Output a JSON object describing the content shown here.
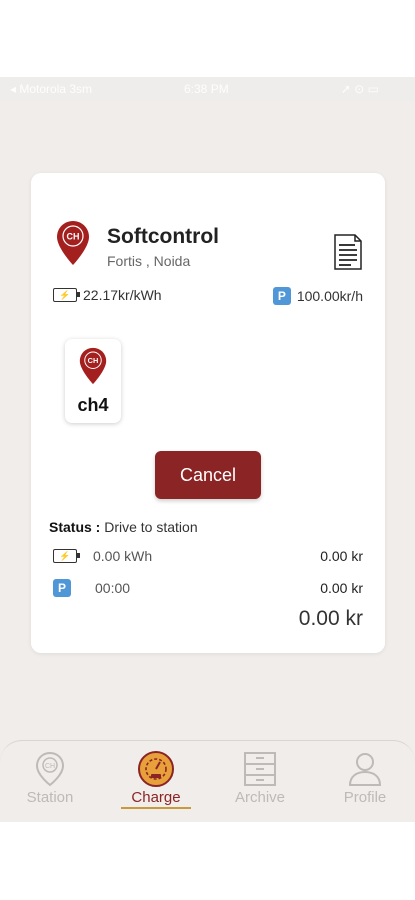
{
  "status_bar": {
    "carrier": "◂ Motorola 3sm",
    "time": "6:38 PM",
    "icons": "➚ ⊙ ▭"
  },
  "station": {
    "badge": "CH",
    "name": "Softcontrol",
    "location": "Fortis , Noida",
    "energy_rate": "22.17kr/kWh",
    "parking_badge": "P",
    "parking_rate": "100.00kr/h"
  },
  "connector": {
    "badge": "CH",
    "label": "ch4"
  },
  "actions": {
    "cancel_label": "Cancel"
  },
  "status": {
    "label": "Status :",
    "value": " Drive to station"
  },
  "details": {
    "energy_value": "0.00 kWh",
    "energy_amount": "0.00 kr",
    "parking_badge": "P",
    "parking_time": "00:00",
    "parking_amount": "0.00 kr",
    "total": "0.00 kr"
  },
  "tabs": [
    {
      "label": "Station",
      "icon": "station-pin-icon"
    },
    {
      "label": "Charge",
      "icon": "charge-gauge-icon"
    },
    {
      "label": "Archive",
      "icon": "archive-cabinet-icon"
    },
    {
      "label": "Profile",
      "icon": "profile-person-icon"
    }
  ],
  "colors": {
    "brand": "#8b2424",
    "accent": "#c99a3c",
    "parking": "#4f97d6",
    "background": "#f0edea"
  }
}
